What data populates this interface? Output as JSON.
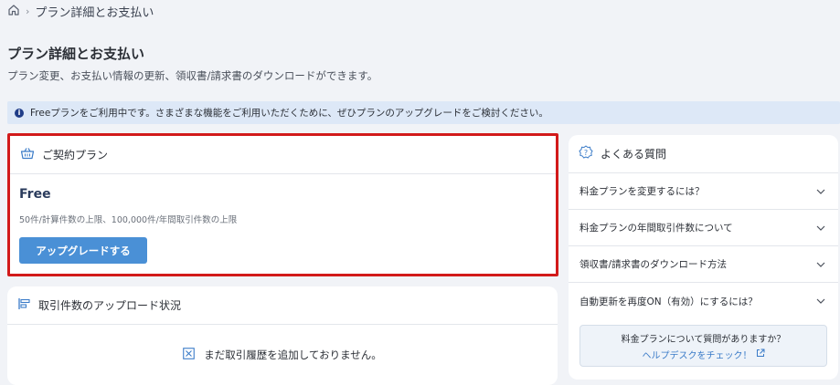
{
  "breadcrumb": {
    "current": "プラン詳細とお支払い"
  },
  "page": {
    "title": "プラン詳細とお支払い",
    "description": "プラン変更、お支払い情報の更新、領収書/請求書のダウンロードができます。"
  },
  "notice": {
    "text": "Freeプランをご利用中です。さまざまな機能をご利用いただくために、ぜひプランのアップグレードをご検討ください。"
  },
  "plan_card": {
    "title": "ご契約プラン",
    "plan_name": "Free",
    "limits": "50件/計算件数の上限、100,000件/年間取引件数の上限",
    "upgrade_label": "アップグレードする"
  },
  "upload_card": {
    "title": "取引件数のアップロード状況",
    "empty_text": "まだ取引履歴を追加しておりません。"
  },
  "faq": {
    "title": "よくある質問",
    "items": [
      {
        "label": "料金プランを変更するには？"
      },
      {
        "label": "料金プランの年間取引件数について"
      },
      {
        "label": "領収書/請求書のダウンロード方法"
      },
      {
        "label": "自動更新を再度ON（有効）にするには？"
      }
    ],
    "helpdesk_question": "料金プランについて質問がありますか？",
    "helpdesk_link": "ヘルプデスクをチェック！"
  },
  "colors": {
    "accent": "#4a90d6",
    "highlight_border": "#d21a1a",
    "notice_bg": "#dde8f7"
  }
}
